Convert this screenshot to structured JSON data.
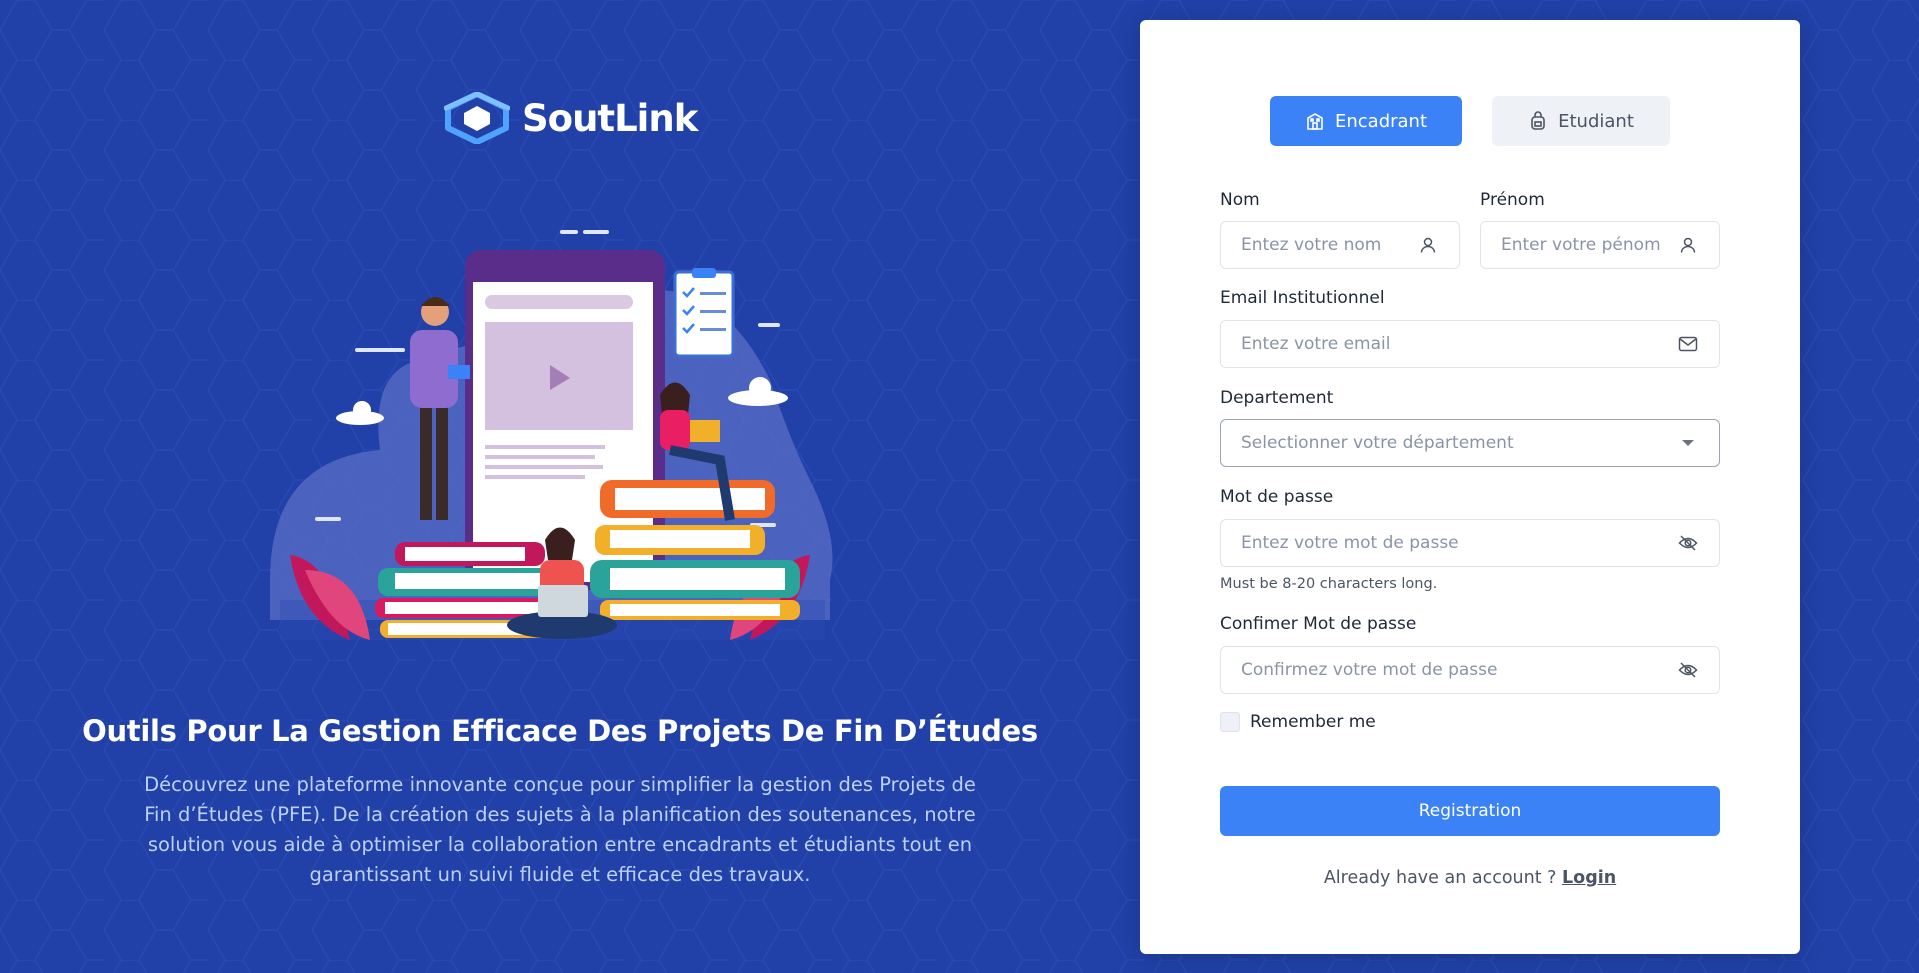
{
  "brand": {
    "name": "SoutLink",
    "logo_icon": "graduation-cap-hex-icon"
  },
  "hero": {
    "title": "Outils Pour La Gestion Efficace Des Projets De Fin D’Études",
    "description": "Découvrez une plateforme innovante conçue pour simplifier la gestion des Projets de Fin d’Études (PFE). De la création des sujets à la planification des soutenances, notre solution vous aide à optimiser la collaboration entre encadrants et étudiants tout en garantissant un suivi fluide et efficace des travaux."
  },
  "roles": [
    {
      "label": "Encadrant",
      "icon": "building-icon",
      "active": true
    },
    {
      "label": "Etudiant",
      "icon": "backpack-icon",
      "active": false
    }
  ],
  "form": {
    "nom": {
      "label": "Nom",
      "placeholder": "Entez votre nom",
      "icon": "user-icon"
    },
    "prenom": {
      "label": "Prénom",
      "placeholder": "Enter votre pénom",
      "icon": "user-icon"
    },
    "email": {
      "label": "Email Institutionnel",
      "placeholder": "Entez votre email",
      "icon": "mail-icon"
    },
    "departement": {
      "label": "Departement",
      "placeholder": "Selectionner votre département",
      "icon": "caret-down-icon"
    },
    "password": {
      "label": "Mot de passe",
      "placeholder": "Entez votre mot de passe",
      "icon": "eye-off-icon",
      "hint": "Must be 8-20 characters long."
    },
    "confirm_password": {
      "label": "Confimer Mot de passe",
      "placeholder": "Confirmez votre mot de passe",
      "icon": "eye-off-icon"
    },
    "remember": {
      "label": "Remember me",
      "checked": false
    },
    "submit_label": "Registration",
    "login_prompt": "Already have an account ?",
    "login_link": "Login"
  },
  "colors": {
    "background": "#2141a8",
    "primary": "#3b82f6",
    "card": "#ffffff",
    "hero_text": "#bcd0f7"
  }
}
